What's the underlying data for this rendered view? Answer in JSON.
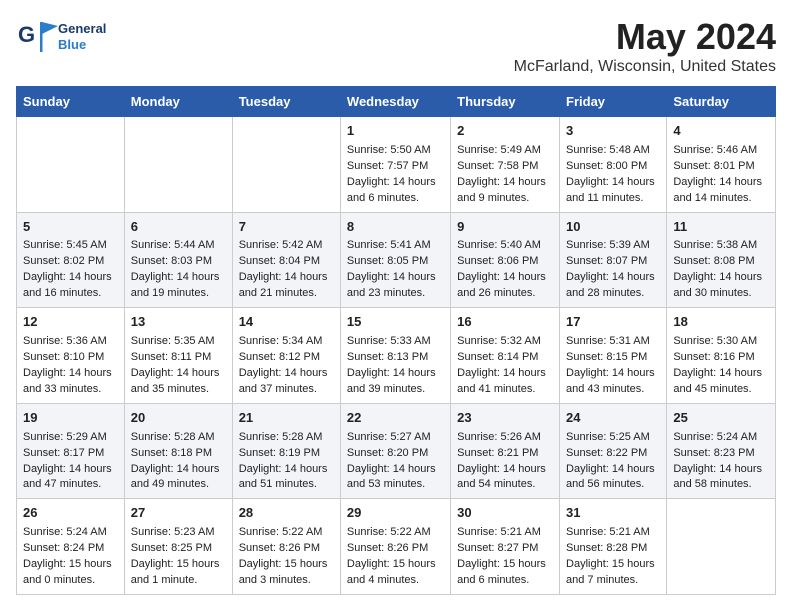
{
  "header": {
    "logo_line1": "General",
    "logo_line2": "Blue",
    "month": "May 2024",
    "location": "McFarland, Wisconsin, United States"
  },
  "weekdays": [
    "Sunday",
    "Monday",
    "Tuesday",
    "Wednesday",
    "Thursday",
    "Friday",
    "Saturday"
  ],
  "weeks": [
    [
      {
        "day": "",
        "info": ""
      },
      {
        "day": "",
        "info": ""
      },
      {
        "day": "",
        "info": ""
      },
      {
        "day": "1",
        "info": "Sunrise: 5:50 AM\nSunset: 7:57 PM\nDaylight: 14 hours\nand 6 minutes."
      },
      {
        "day": "2",
        "info": "Sunrise: 5:49 AM\nSunset: 7:58 PM\nDaylight: 14 hours\nand 9 minutes."
      },
      {
        "day": "3",
        "info": "Sunrise: 5:48 AM\nSunset: 8:00 PM\nDaylight: 14 hours\nand 11 minutes."
      },
      {
        "day": "4",
        "info": "Sunrise: 5:46 AM\nSunset: 8:01 PM\nDaylight: 14 hours\nand 14 minutes."
      }
    ],
    [
      {
        "day": "5",
        "info": "Sunrise: 5:45 AM\nSunset: 8:02 PM\nDaylight: 14 hours\nand 16 minutes."
      },
      {
        "day": "6",
        "info": "Sunrise: 5:44 AM\nSunset: 8:03 PM\nDaylight: 14 hours\nand 19 minutes."
      },
      {
        "day": "7",
        "info": "Sunrise: 5:42 AM\nSunset: 8:04 PM\nDaylight: 14 hours\nand 21 minutes."
      },
      {
        "day": "8",
        "info": "Sunrise: 5:41 AM\nSunset: 8:05 PM\nDaylight: 14 hours\nand 23 minutes."
      },
      {
        "day": "9",
        "info": "Sunrise: 5:40 AM\nSunset: 8:06 PM\nDaylight: 14 hours\nand 26 minutes."
      },
      {
        "day": "10",
        "info": "Sunrise: 5:39 AM\nSunset: 8:07 PM\nDaylight: 14 hours\nand 28 minutes."
      },
      {
        "day": "11",
        "info": "Sunrise: 5:38 AM\nSunset: 8:08 PM\nDaylight: 14 hours\nand 30 minutes."
      }
    ],
    [
      {
        "day": "12",
        "info": "Sunrise: 5:36 AM\nSunset: 8:10 PM\nDaylight: 14 hours\nand 33 minutes."
      },
      {
        "day": "13",
        "info": "Sunrise: 5:35 AM\nSunset: 8:11 PM\nDaylight: 14 hours\nand 35 minutes."
      },
      {
        "day": "14",
        "info": "Sunrise: 5:34 AM\nSunset: 8:12 PM\nDaylight: 14 hours\nand 37 minutes."
      },
      {
        "day": "15",
        "info": "Sunrise: 5:33 AM\nSunset: 8:13 PM\nDaylight: 14 hours\nand 39 minutes."
      },
      {
        "day": "16",
        "info": "Sunrise: 5:32 AM\nSunset: 8:14 PM\nDaylight: 14 hours\nand 41 minutes."
      },
      {
        "day": "17",
        "info": "Sunrise: 5:31 AM\nSunset: 8:15 PM\nDaylight: 14 hours\nand 43 minutes."
      },
      {
        "day": "18",
        "info": "Sunrise: 5:30 AM\nSunset: 8:16 PM\nDaylight: 14 hours\nand 45 minutes."
      }
    ],
    [
      {
        "day": "19",
        "info": "Sunrise: 5:29 AM\nSunset: 8:17 PM\nDaylight: 14 hours\nand 47 minutes."
      },
      {
        "day": "20",
        "info": "Sunrise: 5:28 AM\nSunset: 8:18 PM\nDaylight: 14 hours\nand 49 minutes."
      },
      {
        "day": "21",
        "info": "Sunrise: 5:28 AM\nSunset: 8:19 PM\nDaylight: 14 hours\nand 51 minutes."
      },
      {
        "day": "22",
        "info": "Sunrise: 5:27 AM\nSunset: 8:20 PM\nDaylight: 14 hours\nand 53 minutes."
      },
      {
        "day": "23",
        "info": "Sunrise: 5:26 AM\nSunset: 8:21 PM\nDaylight: 14 hours\nand 54 minutes."
      },
      {
        "day": "24",
        "info": "Sunrise: 5:25 AM\nSunset: 8:22 PM\nDaylight: 14 hours\nand 56 minutes."
      },
      {
        "day": "25",
        "info": "Sunrise: 5:24 AM\nSunset: 8:23 PM\nDaylight: 14 hours\nand 58 minutes."
      }
    ],
    [
      {
        "day": "26",
        "info": "Sunrise: 5:24 AM\nSunset: 8:24 PM\nDaylight: 15 hours\nand 0 minutes."
      },
      {
        "day": "27",
        "info": "Sunrise: 5:23 AM\nSunset: 8:25 PM\nDaylight: 15 hours\nand 1 minute."
      },
      {
        "day": "28",
        "info": "Sunrise: 5:22 AM\nSunset: 8:26 PM\nDaylight: 15 hours\nand 3 minutes."
      },
      {
        "day": "29",
        "info": "Sunrise: 5:22 AM\nSunset: 8:26 PM\nDaylight: 15 hours\nand 4 minutes."
      },
      {
        "day": "30",
        "info": "Sunrise: 5:21 AM\nSunset: 8:27 PM\nDaylight: 15 hours\nand 6 minutes."
      },
      {
        "day": "31",
        "info": "Sunrise: 5:21 AM\nSunset: 8:28 PM\nDaylight: 15 hours\nand 7 minutes."
      },
      {
        "day": "",
        "info": ""
      }
    ]
  ]
}
